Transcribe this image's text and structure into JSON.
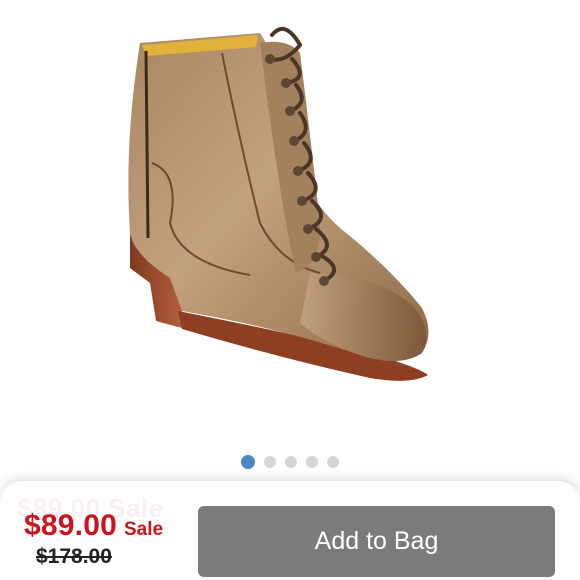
{
  "product": {
    "image_icon": "ankle-boot-image",
    "colors": {
      "leather": "#b08a64",
      "heel": "#9a4a2e",
      "lace": "#4a3526",
      "lining": "#e1b23a"
    }
  },
  "carousel": {
    "total": 5,
    "active_index": 0,
    "active_color": "#4a88c3",
    "inactive_color": "#d6d6d6"
  },
  "purchase_bar": {
    "ghost_price": "$89.00 Sale",
    "sale_price": "$89.00",
    "sale_label": "Sale",
    "original_price": "$178.00",
    "add_to_bag_label": "Add to Bag",
    "price_color": "#c9151e",
    "button_color": "#7b7b7b"
  }
}
